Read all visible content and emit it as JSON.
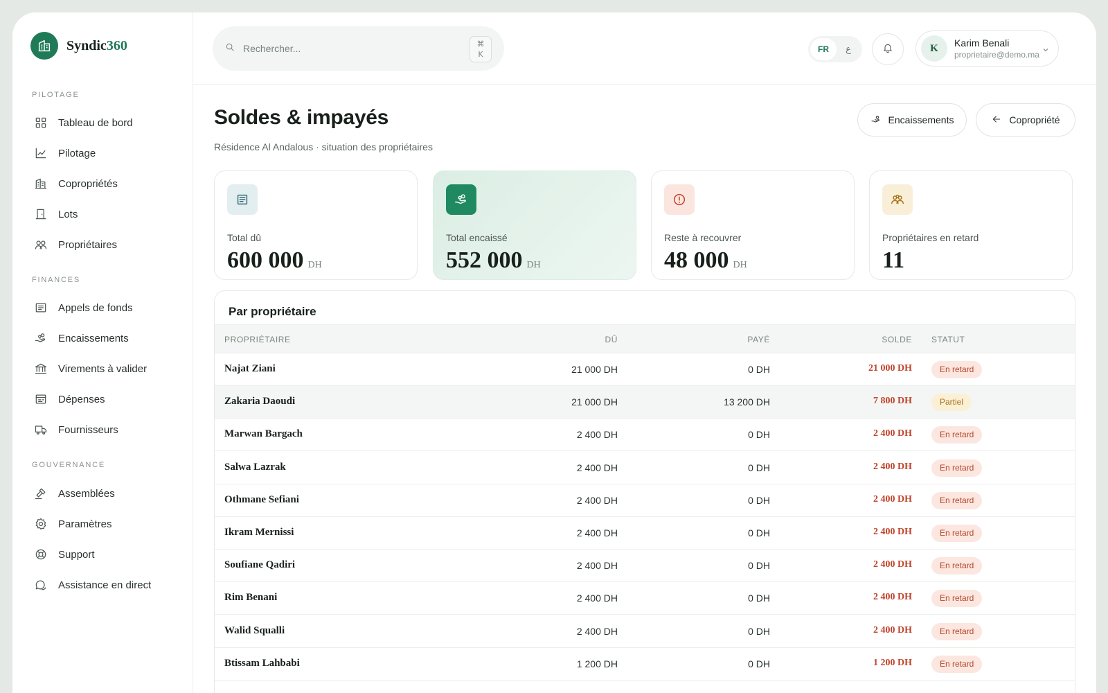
{
  "brand": {
    "name_main": "Syndic",
    "name_accent": "360"
  },
  "sidebar": {
    "sections": [
      {
        "title": "PILOTAGE",
        "items": [
          {
            "label": "Tableau de bord",
            "icon": "grid-icon"
          },
          {
            "label": "Pilotage",
            "icon": "chart-line-icon"
          },
          {
            "label": "Copropriétés",
            "icon": "building-icon"
          },
          {
            "label": "Lots",
            "icon": "door-icon"
          },
          {
            "label": "Propriétaires",
            "icon": "users-icon"
          }
        ]
      },
      {
        "title": "FINANCES",
        "items": [
          {
            "label": "Appels de fonds",
            "icon": "receipt-icon"
          },
          {
            "label": "Encaissements",
            "icon": "hand-coins-icon"
          },
          {
            "label": "Virements à valider",
            "icon": "bank-icon"
          },
          {
            "label": "Dépenses",
            "icon": "expense-icon"
          },
          {
            "label": "Fournisseurs",
            "icon": "truck-icon"
          }
        ]
      },
      {
        "title": "GOUVERNANCE",
        "items": [
          {
            "label": "Assemblées",
            "icon": "gavel-icon"
          },
          {
            "label": "Paramètres",
            "icon": "gear-icon"
          },
          {
            "label": "Support",
            "icon": "lifebuoy-icon"
          },
          {
            "label": "Assistance en direct",
            "icon": "chat-icon"
          }
        ]
      }
    ]
  },
  "topbar": {
    "search_placeholder": "Rechercher...",
    "shortcut_symbol": "⌘",
    "shortcut_key": "K",
    "lang_active": "FR",
    "lang_other": "ع",
    "user_initial": "K",
    "user_name": "Karim Benali",
    "user_email": "proprietaire@demo.ma"
  },
  "header": {
    "title": "Soldes & impayés",
    "subtitle": "Résidence Al Andalous · situation des propriétaires",
    "btn_encaissements": "Encaissements",
    "btn_copropriete": "Copropriété"
  },
  "kpis": [
    {
      "label": "Total dû",
      "value": "600 000",
      "unit": "DH",
      "icon": "receipt-icon"
    },
    {
      "label": "Total encaissé",
      "value": "552 000",
      "unit": "DH",
      "icon": "hand-coins-icon"
    },
    {
      "label": "Reste à recouvrer",
      "value": "48 000",
      "unit": "DH",
      "icon": "alert-circle-icon"
    },
    {
      "label": "Propriétaires en retard",
      "value": "11",
      "unit": "",
      "icon": "users-icon"
    }
  ],
  "colors": {
    "accent": "#1f7a58",
    "danger": "#c0442b",
    "warning": "#a8741b"
  },
  "table": {
    "title": "Par propriétaire",
    "headers": {
      "owner": "PROPRIÉTAIRE",
      "due": "DÛ",
      "paid": "PAYÉ",
      "balance": "SOLDE",
      "status": "STATUT"
    },
    "rows": [
      {
        "name": "Najat Ziani",
        "due": "21 000 DH",
        "paid": "0 DH",
        "balance": "21 000 DH",
        "status": "En retard"
      },
      {
        "name": "Zakaria Daoudi",
        "due": "21 000 DH",
        "paid": "13 200 DH",
        "balance": "7 800 DH",
        "status": "Partiel"
      },
      {
        "name": "Marwan Bargach",
        "due": "2 400 DH",
        "paid": "0 DH",
        "balance": "2 400 DH",
        "status": "En retard"
      },
      {
        "name": "Salwa Lazrak",
        "due": "2 400 DH",
        "paid": "0 DH",
        "balance": "2 400 DH",
        "status": "En retard"
      },
      {
        "name": "Othmane Sefiani",
        "due": "2 400 DH",
        "paid": "0 DH",
        "balance": "2 400 DH",
        "status": "En retard"
      },
      {
        "name": "Ikram Mernissi",
        "due": "2 400 DH",
        "paid": "0 DH",
        "balance": "2 400 DH",
        "status": "En retard"
      },
      {
        "name": "Soufiane Qadiri",
        "due": "2 400 DH",
        "paid": "0 DH",
        "balance": "2 400 DH",
        "status": "En retard"
      },
      {
        "name": "Rim Benani",
        "due": "2 400 DH",
        "paid": "0 DH",
        "balance": "2 400 DH",
        "status": "En retard"
      },
      {
        "name": "Walid Squalli",
        "due": "2 400 DH",
        "paid": "0 DH",
        "balance": "2 400 DH",
        "status": "En retard"
      },
      {
        "name": "Btissam Lahbabi",
        "due": "1 200 DH",
        "paid": "0 DH",
        "balance": "1 200 DH",
        "status": "En retard"
      }
    ]
  }
}
